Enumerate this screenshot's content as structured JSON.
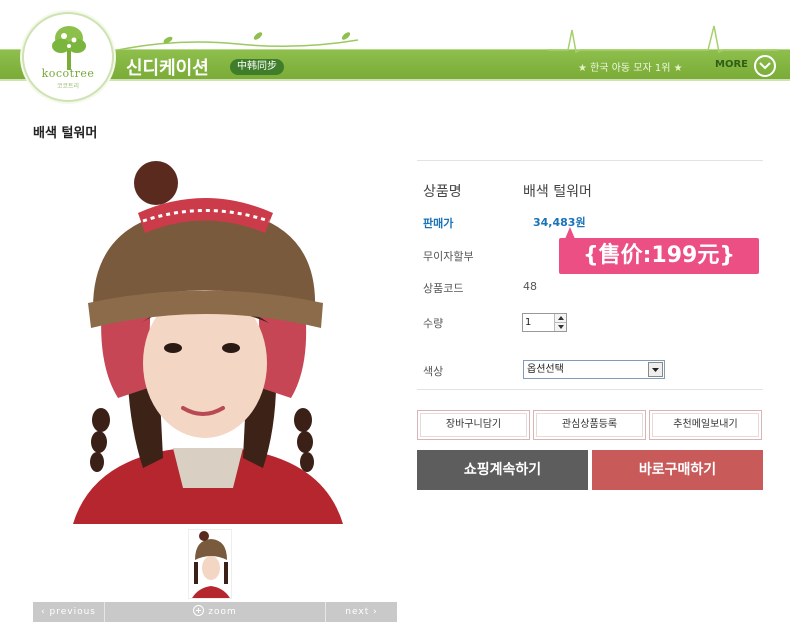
{
  "header": {
    "logo_text": "kocotree",
    "logo_sub": "코코트리",
    "brand_name": "신디케이션",
    "brand_badge": "中韩同步",
    "slogan": "한국 아동 모자 1위",
    "more_label": "MORE"
  },
  "product": {
    "title": "배색 털워머",
    "name_label": "상품명",
    "name_value": "배색 털워머",
    "price_label": "판매가",
    "price_value": "34,483원",
    "price_callout": "{售价:199元}",
    "installment_label": "무이자할부",
    "code_label": "상품코드",
    "code_value": "48",
    "qty_label": "수량",
    "qty_value": "1",
    "color_label": "색상",
    "color_selected": "옵션선택"
  },
  "gallery": {
    "prev_label": "previous",
    "zoom_label": "zoom",
    "next_label": "next"
  },
  "actions": {
    "cart_label": "장바구니담기",
    "wish_label": "관심상품등록",
    "mail_label": "추천메일보내기",
    "continue_label": "쇼핑계속하기",
    "buy_label": "바로구매하기"
  },
  "colors": {
    "brand_green": "#7aac37",
    "price_blue": "#1a73b8",
    "callout_pink": "#ec4f83",
    "buy_red": "#c85a5a",
    "continue_gray": "#5d5d5d"
  }
}
